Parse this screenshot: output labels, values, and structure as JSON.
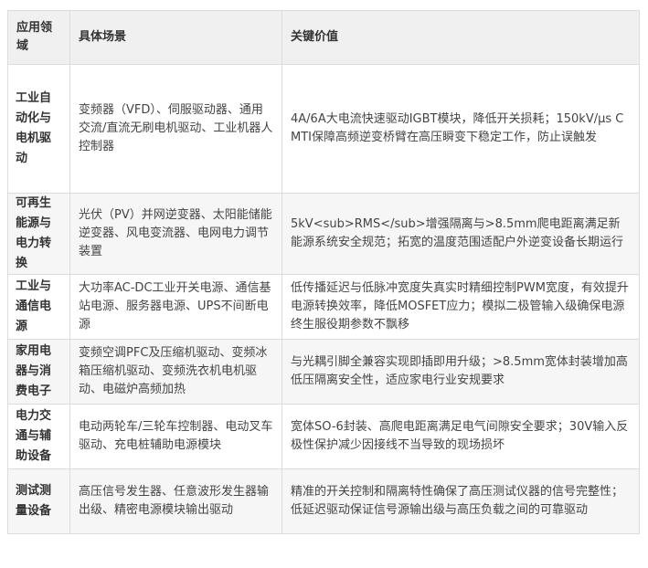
{
  "table": {
    "headers": [
      "应用领域",
      "具体场景",
      "关键价值"
    ],
    "rows": [
      {
        "field": "工业自动化与电机驱动",
        "scene": "变频器（VFD）、伺服驱动器、通用交流/直流无刷电机驱动、工业机器人控制器",
        "value": "4A/6A大电流快速驱动IGBT模块，降低开关损耗；150kV/μs CMTI保障高频逆变桥臂在高压瞬变下稳定工作，防止误触发"
      },
      {
        "field": "可再生能源与电力转换",
        "scene": "光伏（PV）并网逆变器、太阳能储能逆变器、风电变流器、电网电力调节装置",
        "value": "5kV<sub>RMS</sub>增强隔离与>8.5mm爬电距离满足新能源系统安全规范；拓宽的温度范围适配户外逆变设备长期运行"
      },
      {
        "field": "工业与通信电源",
        "scene": "大功率AC-DC工业开关电源、通信基站电源、服务器电源、UPS不间断电源",
        "value": "低传播延迟与低脉冲宽度失真实时精细控制PWM宽度，有效提升电源转换效率，降低MOSFET应力；模拟二极管输入级确保电源终生服役期参数不飘移"
      },
      {
        "field": "家用电器与消费电子",
        "scene": "变频空调PFC及压缩机驱动、变频冰箱压缩机驱动、变频洗衣机电机驱动、电磁炉高频加热",
        "value": "与光耦引脚全兼容实现即插即用升级；>8.5mm宽体封装增加高低压隔离安全性，适应家电行业安规要求"
      },
      {
        "field": "电力交通与辅助设备",
        "scene": "电动两轮车/三轮车控制器、电动叉车驱动、充电桩辅助电源模块",
        "value": "宽体SO-6封装、高爬电距离满足电气间隙安全要求；30V输入反极性保护减少因接线不当导致的现场损坏"
      },
      {
        "field": "测试测量设备",
        "scene": "高压信号发生器、任意波形发生器输出级、精密电源模块输出驱动",
        "value": "精准的开关控制和隔离特性确保了高压测试仪器的信号完整性；低延迟驱动保证信号源输出级与高压负载之间的可靠驱动"
      }
    ]
  }
}
